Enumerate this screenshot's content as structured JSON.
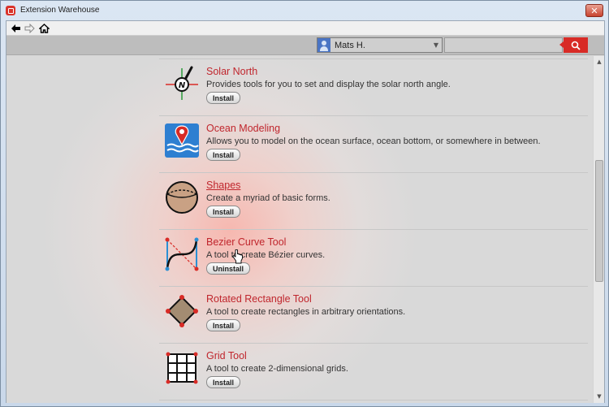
{
  "window": {
    "title": "Extension Warehouse",
    "close_label": "✕",
    "accent": "#d82b26"
  },
  "nav": {
    "back_icon": "back-arrow-icon",
    "forward_icon": "forward-arrow-icon",
    "home_icon": "home-icon"
  },
  "topbar": {
    "user_name": "Mats H.",
    "search_placeholder": "",
    "search_value": ""
  },
  "extensions": [
    {
      "name": "Solar North",
      "description": "Provides tools for you to set and display the solar north angle.",
      "button": "Install"
    },
    {
      "name": "Ocean Modeling",
      "description": "Allows you to model on the ocean surface, ocean bottom, or somewhere in between.",
      "button": "Install"
    },
    {
      "name": "Shapes",
      "description": "Create a myriad of basic forms.",
      "button": "Install"
    },
    {
      "name": "Bezier Curve Tool",
      "description": "A tool to create Bézier curves.",
      "button": "Uninstall"
    },
    {
      "name": "Rotated Rectangle Tool",
      "description": "A tool to create rectangles in arbitrary orientations.",
      "button": "Install"
    },
    {
      "name": "Grid Tool",
      "description": "A tool to create 2-dimensional grids.",
      "button": "Install"
    }
  ]
}
